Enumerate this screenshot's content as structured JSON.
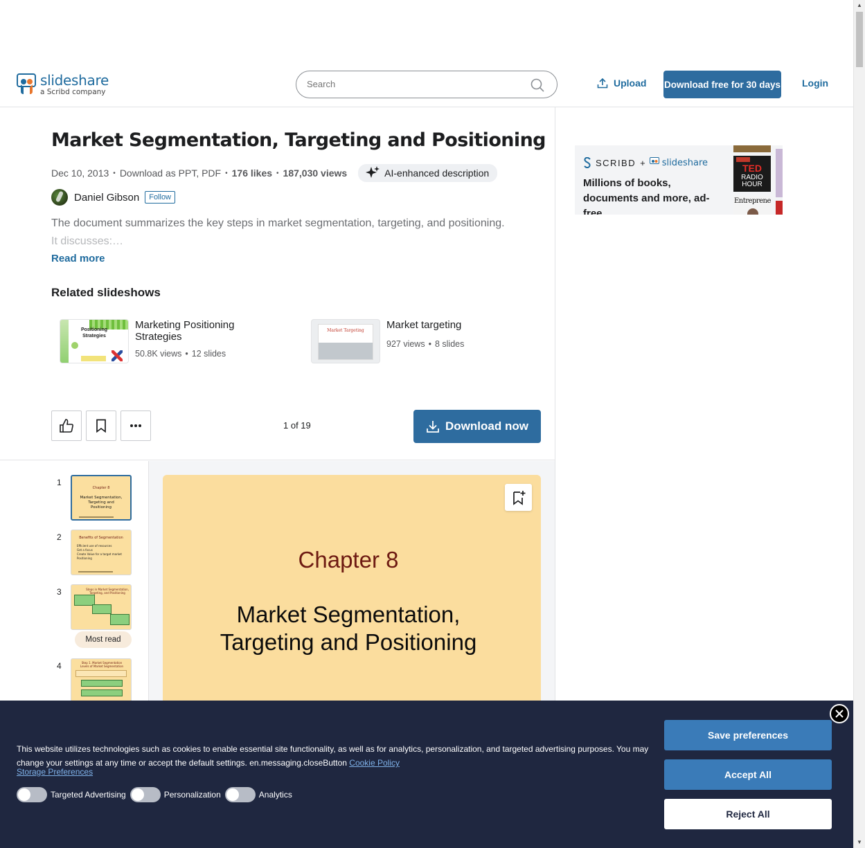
{
  "header": {
    "logo_name": "slideshare",
    "logo_sub": "a Scribd company",
    "search_placeholder": "Search",
    "upload_label": "Upload",
    "download_free_label": "Download free for 30 days",
    "login_label": "Login"
  },
  "document": {
    "title": "Market Segmentation, Targeting and Positioning",
    "date": "Dec 10, 2013",
    "download_as": "Download as PPT, PDF",
    "likes": "176 likes",
    "views": "187,030 views",
    "ai_label": "AI-enhanced description",
    "author": "Daniel Gibson",
    "follow_label": "Follow",
    "description_line1": "The document summarizes the key steps in market segmentation, targeting, and positioning.",
    "description_line2": "It discusses:…",
    "read_more": "Read more"
  },
  "related": {
    "heading": "Related slideshows",
    "items": [
      {
        "title": "Marketing Positioning Strategies",
        "views": "50.8K views",
        "slides": "12 slides",
        "thumb_text": "Positioning Strategies"
      },
      {
        "title": "Market targeting",
        "views": "927 views",
        "slides": "8 slides",
        "thumb_text": "Market Targeting"
      }
    ]
  },
  "toolbar": {
    "page_count": "1 of 19",
    "download_now": "Download now"
  },
  "thumbnails": [
    {
      "num": "1",
      "title": "Chapter 8",
      "body": "Market Segmentation, Targeting and Positioning"
    },
    {
      "num": "2",
      "title": "Benefits of Segmentation",
      "bullets": [
        "Efficient use of resources",
        "Get a focus",
        "Create Value for a target market",
        "Positioning"
      ]
    },
    {
      "num": "3",
      "title": "Steps in Market Segmentation, Targeting, and Positioning"
    },
    {
      "num": "4",
      "title": "Step 1. Market Segmentation Levels of Market Segmentation"
    }
  ],
  "most_read_label": "Most read",
  "slide": {
    "chapter": "Chapter 8",
    "title_line1": "Market Segmentation,",
    "title_line2": "Targeting and Positioning"
  },
  "ad": {
    "brand_scribd": "SCRIBD",
    "brand_plus": "+",
    "brand_slideshare": "slideshare",
    "text": "Millions of books, documents and more, ad-free.",
    "book_ted_line1": "TED",
    "book_ted_line2": "RADIO",
    "book_ted_line3": "HOUR",
    "book_entrepreneur": "Entrepreneur"
  },
  "cookie": {
    "text": "This website utilizes technologies such as cookies to enable essential site functionality, as well as for analytics, personalization, and targeted advertising purposes. You may change your settings at any time or accept the default settings. en.messaging.closeButton",
    "policy_link": "Cookie Policy",
    "storage_link": "Storage Preferences",
    "toggles": [
      "Targeted Advertising",
      "Personalization",
      "Analytics"
    ],
    "save_label": "Save preferences",
    "accept_label": "Accept All",
    "reject_label": "Reject All"
  },
  "colors": {
    "brand_blue": "#2e6c9f",
    "slide_bg": "#fbdd9e",
    "cookie_bg": "#1f2740"
  }
}
